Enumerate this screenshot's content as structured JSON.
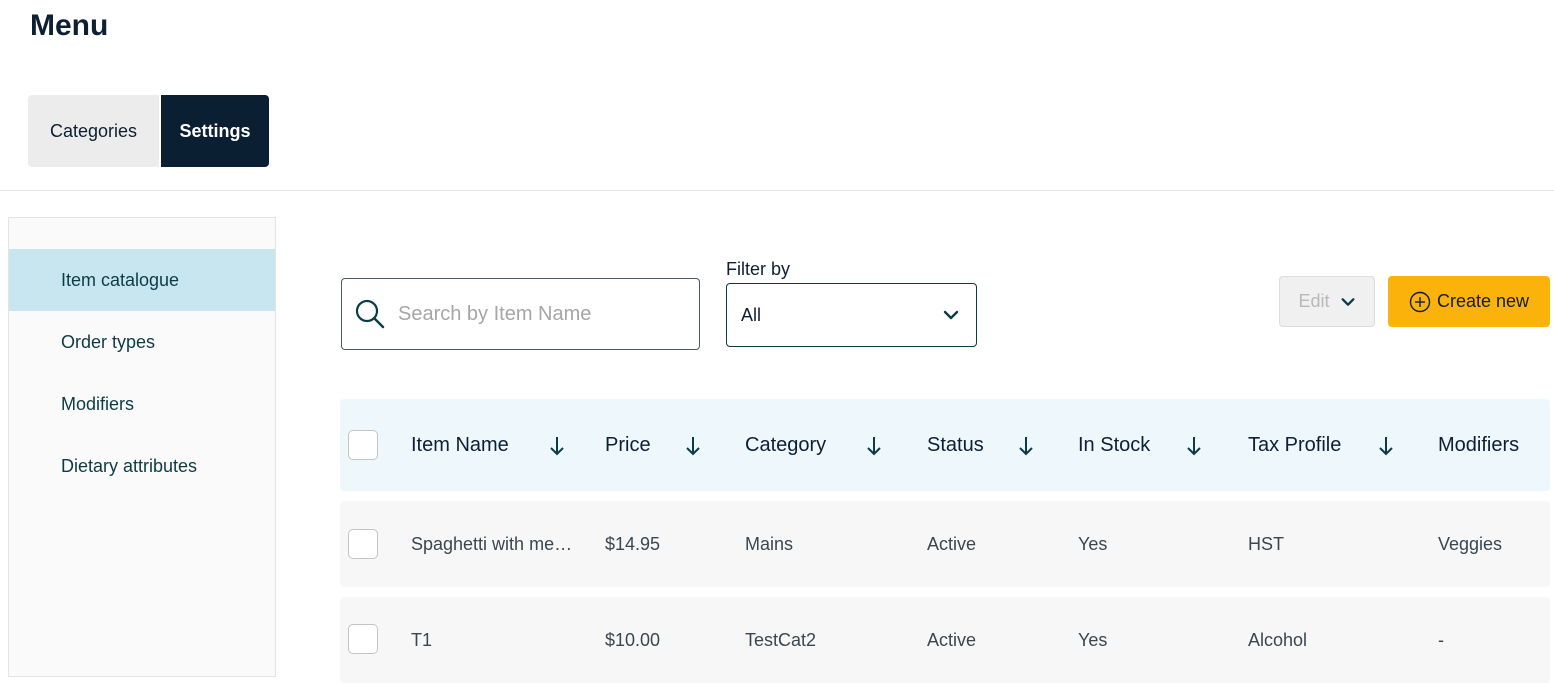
{
  "page": {
    "title": "Menu"
  },
  "tabs": [
    {
      "label": "Categories",
      "active": false
    },
    {
      "label": "Settings",
      "active": true
    }
  ],
  "sidebar": {
    "items": [
      {
        "label": "Item catalogue",
        "active": true
      },
      {
        "label": "Order types",
        "active": false
      },
      {
        "label": "Modifiers",
        "active": false
      },
      {
        "label": "Dietary attributes",
        "active": false
      }
    ]
  },
  "search": {
    "placeholder": "Search by Item Name",
    "value": ""
  },
  "filter": {
    "label": "Filter by",
    "selected": "All"
  },
  "toolbar": {
    "edit_label": "Edit",
    "create_label": "Create new"
  },
  "table": {
    "columns": [
      "Item Name",
      "Price",
      "Category",
      "Status",
      "In Stock",
      "Tax Profile",
      "Modifiers"
    ],
    "rows": [
      {
        "name": "Spaghetti with me…",
        "price": "$14.95",
        "category": "Mains",
        "status": "Active",
        "in_stock": "Yes",
        "tax_profile": "HST",
        "modifiers": "Veggies"
      },
      {
        "name": "T1",
        "price": "$10.00",
        "category": "TestCat2",
        "status": "Active",
        "in_stock": "Yes",
        "tax_profile": "Alcohol",
        "modifiers": "-"
      }
    ]
  },
  "colors": {
    "accent": "#fbb20a",
    "dark_navy": "#0b1f33",
    "active_sidebar": "#c8e6f0",
    "header_bg": "#eef7fb"
  },
  "icons": {
    "search": "search-icon",
    "chevron": "chevron-down-icon",
    "sort": "arrow-down-icon",
    "create": "plus-circle-icon"
  }
}
